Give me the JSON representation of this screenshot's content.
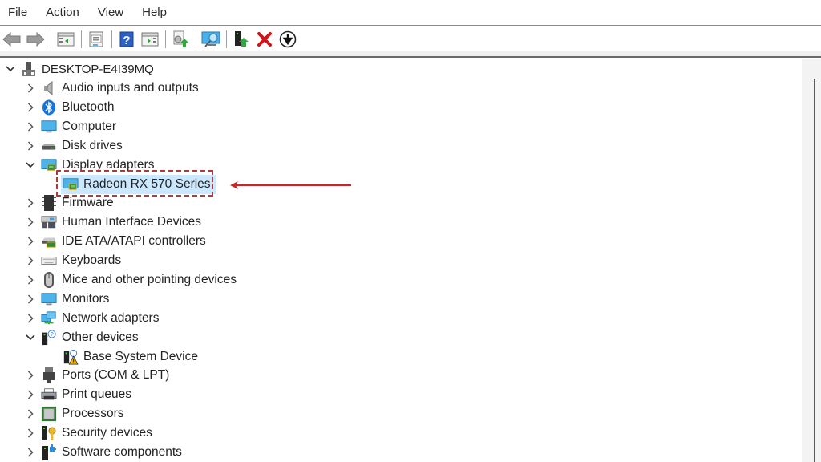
{
  "menubar": {
    "items": [
      "File",
      "Action",
      "View",
      "Help"
    ]
  },
  "toolbar": {
    "buttons": [
      {
        "name": "back",
        "icon": "arrow-left-icon"
      },
      {
        "name": "forward",
        "icon": "arrow-right-icon"
      },
      {
        "name": "show-hide-console-tree",
        "icon": "console-tree-icon"
      },
      {
        "name": "properties",
        "icon": "properties-icon"
      },
      {
        "name": "help",
        "icon": "help-icon"
      },
      {
        "name": "show-hide-action-pane",
        "icon": "action-pane-icon"
      },
      {
        "name": "update-driver",
        "icon": "update-driver-icon"
      },
      {
        "name": "scan-hardware-changes",
        "icon": "scan-hardware-icon"
      },
      {
        "name": "enable-device",
        "icon": "enable-device-icon"
      },
      {
        "name": "uninstall-device",
        "icon": "uninstall-icon"
      },
      {
        "name": "disable-device",
        "icon": "disable-device-icon"
      }
    ]
  },
  "tree": {
    "root": {
      "label": "DESKTOP-E4I39MQ",
      "expanded": true
    },
    "categories": [
      {
        "label": "Audio inputs and outputs",
        "icon": "speaker-icon",
        "expanded": false
      },
      {
        "label": "Bluetooth",
        "icon": "bluetooth-icon",
        "expanded": false
      },
      {
        "label": "Computer",
        "icon": "computer-icon",
        "expanded": false
      },
      {
        "label": "Disk drives",
        "icon": "disk-drive-icon",
        "expanded": false
      },
      {
        "label": "Display adapters",
        "icon": "display-adapter-icon",
        "expanded": true,
        "children": [
          {
            "label": "Radeon RX 570 Series",
            "icon": "display-adapter-icon",
            "selected": true
          }
        ]
      },
      {
        "label": "Firmware",
        "icon": "firmware-icon",
        "expanded": false
      },
      {
        "label": "Human Interface Devices",
        "icon": "hid-icon",
        "expanded": false
      },
      {
        "label": "IDE ATA/ATAPI controllers",
        "icon": "ide-controller-icon",
        "expanded": false
      },
      {
        "label": "Keyboards",
        "icon": "keyboard-icon",
        "expanded": false
      },
      {
        "label": "Mice and other pointing devices",
        "icon": "mouse-icon",
        "expanded": false
      },
      {
        "label": "Monitors",
        "icon": "monitor-icon",
        "expanded": false
      },
      {
        "label": "Network adapters",
        "icon": "network-icon",
        "expanded": false
      },
      {
        "label": "Other devices",
        "icon": "unknown-device-icon",
        "expanded": true,
        "children": [
          {
            "label": "Base System Device",
            "icon": "warning-device-icon",
            "selected": false
          }
        ]
      },
      {
        "label": "Ports (COM & LPT)",
        "icon": "port-icon",
        "expanded": false
      },
      {
        "label": "Print queues",
        "icon": "printer-icon",
        "expanded": false
      },
      {
        "label": "Processors",
        "icon": "processor-icon",
        "expanded": false
      },
      {
        "label": "Security devices",
        "icon": "security-icon",
        "expanded": false
      },
      {
        "label": "Software components",
        "icon": "software-component-icon",
        "expanded": false
      }
    ]
  },
  "annotation": {
    "highlight_color": "#b03a3a",
    "arrow_color": "#c62828",
    "target": "Radeon RX 570 Series"
  },
  "colors": {
    "selection_bg": "#cce8ff",
    "text": "#232323"
  }
}
